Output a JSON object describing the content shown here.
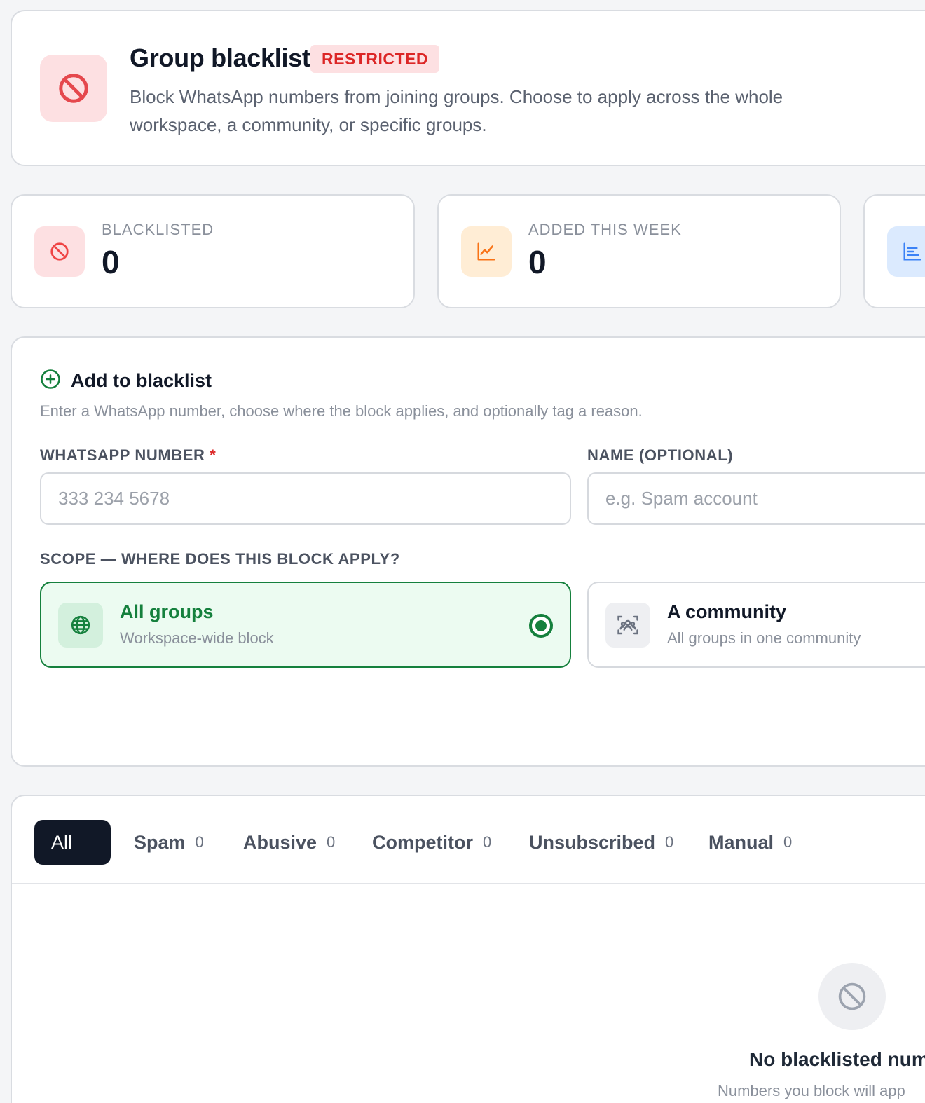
{
  "header": {
    "title": "Group blacklist",
    "badge": "RESTRICTED",
    "description": "Block WhatsApp numbers from joining groups. Choose to apply across the whole workspace, a community, or specific groups.",
    "icon": "ban-icon"
  },
  "stats": [
    {
      "label": "BLACKLISTED",
      "value": "0",
      "icon": "ban-icon",
      "color": "#ef4444",
      "bg": "#fde0e2"
    },
    {
      "label": "ADDED THIS WEEK",
      "value": "0",
      "icon": "trend-chart-icon",
      "color": "#f97316",
      "bg": "#ffedd5"
    },
    {
      "label": "",
      "value": "",
      "icon": "bar-list-icon",
      "color": "#3b82f6",
      "bg": "#dbeafe"
    }
  ],
  "add_form": {
    "title": "Add to blacklist",
    "subtitle": "Enter a WhatsApp number, choose where the block applies, and optionally tag a reason.",
    "number_label": "WHATSAPP NUMBER",
    "required_mark": "*",
    "number_placeholder": "333 234 5678",
    "name_label": "NAME (OPTIONAL)",
    "name_placeholder": "e.g. Spam account",
    "scope_label": "SCOPE — WHERE DOES THIS BLOCK APPLY?",
    "scope_options": [
      {
        "title": "All groups",
        "subtitle": "Workspace-wide block",
        "selected": true,
        "icon": "globe-icon"
      },
      {
        "title": "A community",
        "subtitle": "All groups in one community",
        "selected": false,
        "icon": "community-icon"
      }
    ]
  },
  "filters": {
    "tabs": [
      {
        "label": "All",
        "count": "",
        "active": true
      },
      {
        "label": "Spam",
        "count": "0"
      },
      {
        "label": "Abusive",
        "count": "0"
      },
      {
        "label": "Competitor",
        "count": "0"
      },
      {
        "label": "Unsubscribed",
        "count": "0"
      },
      {
        "label": "Manual",
        "count": "0"
      }
    ]
  },
  "empty_state": {
    "title": "No blacklisted numb",
    "subtitle": "Numbers you block will app",
    "icon": "ban-icon"
  },
  "colors": {
    "accent_green": "#15803d",
    "danger": "#dc2626",
    "dark": "#111827"
  }
}
